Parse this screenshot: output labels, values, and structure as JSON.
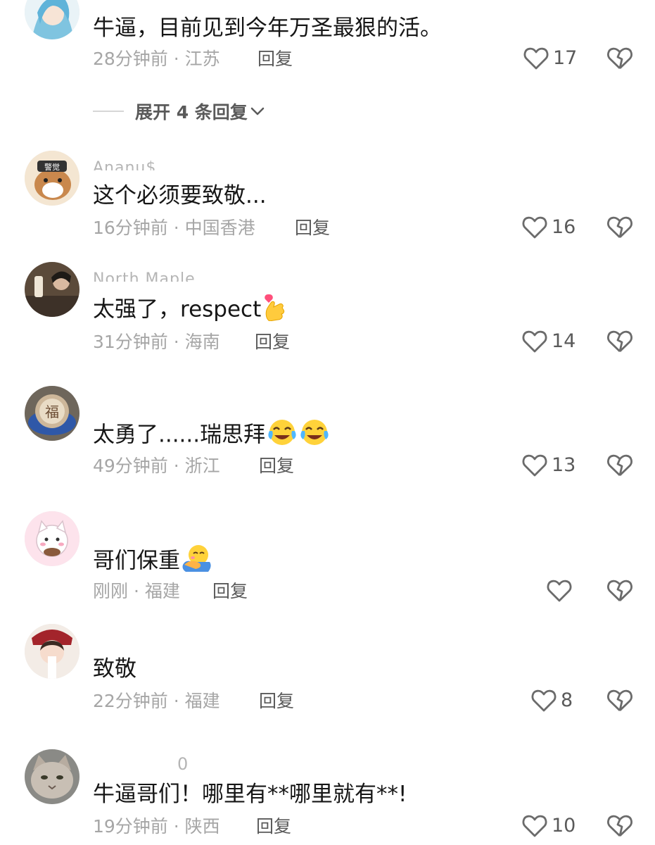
{
  "expand_replies_label": "展开 4 条回复",
  "comments": [
    {
      "username": "",
      "text": "牛逼，目前见到今年万圣最狠的活。",
      "time_location": "28分钟前 · 江苏",
      "reply_label": "回复",
      "likes": "17",
      "avatar_icon": "anime-girl-avatar"
    },
    {
      "username": "Ananu$",
      "text": "这个必须要致敬...",
      "time_location": "16分钟前 · 中国香港",
      "reply_label": "回复",
      "likes": "16",
      "avatar_icon": "cartoon-dog-avatar"
    },
    {
      "username": "North Maple",
      "text": "太强了，respect",
      "emoji": [
        "finger-heart-emoji"
      ],
      "time_location": "31分钟前 · 海南",
      "reply_label": "回复",
      "likes": "14",
      "avatar_icon": "person-photo-avatar"
    },
    {
      "username": "",
      "text": "太勇了......瑞思拜",
      "emoji": [
        "crying-laughing-emoji",
        "crying-laughing-emoji"
      ],
      "time_location": "49分钟前 · 浙江",
      "reply_label": "回复",
      "likes": "13",
      "avatar_icon": "fu-plate-avatar"
    },
    {
      "username": "",
      "text": "哥们保重",
      "emoji": [
        "hug-emoji"
      ],
      "time_location": "刚刚 · 福建",
      "reply_label": "回复",
      "likes": "",
      "avatar_icon": "cartoon-cat-avatar"
    },
    {
      "username": "",
      "text": "致敬",
      "time_location": "22分钟前 · 福建",
      "reply_label": "回复",
      "likes": "8",
      "avatar_icon": "girl-photo-avatar"
    },
    {
      "username": "0",
      "text": "牛逼哥们！哪里有**哪里就有**!",
      "time_location": "19分钟前 · 陕西",
      "reply_label": "回复",
      "likes": "10",
      "avatar_icon": "cat-photo-avatar"
    }
  ],
  "colors": {
    "text": "#161616",
    "meta": "#a6a6a6",
    "reply": "#5a5a5a",
    "icon": "#6b6b6b"
  }
}
